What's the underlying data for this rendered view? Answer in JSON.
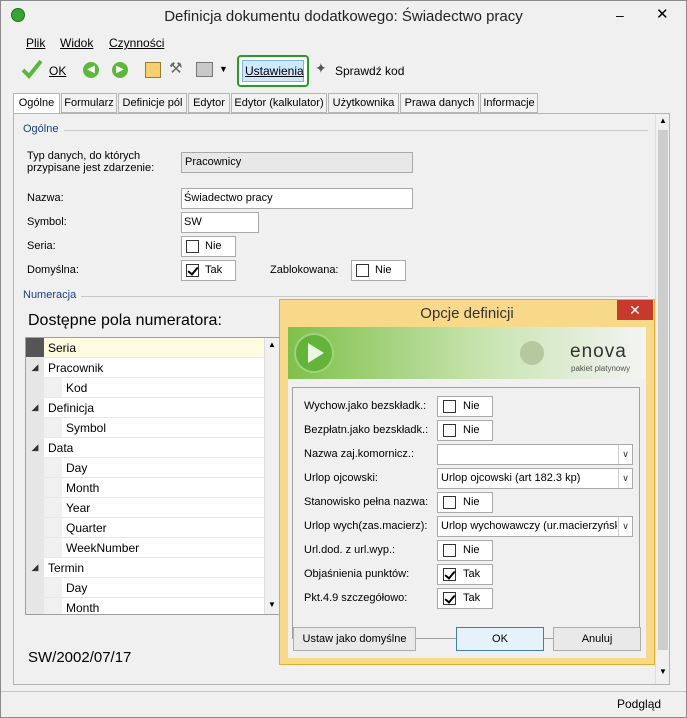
{
  "window": {
    "title": "Definicja dokumentu dodatkowego: Świadectwo pracy"
  },
  "menu": {
    "items": [
      "Plik",
      "Widok",
      "Czynności"
    ]
  },
  "toolbar": {
    "ok_label": "OK",
    "settings_label": "Ustawienia",
    "check_code_label": "Sprawdź kod"
  },
  "tabs": [
    "Ogólne",
    "Formularz",
    "Definicje pól",
    "Edytor",
    "Edytor (kalkulator)",
    "Użytkownika",
    "Prawa danych",
    "Informacje"
  ],
  "general": {
    "section_title": "Ogólne",
    "data_type_label": "Typ danych, do których przypisane jest zdarzenie:",
    "data_type_value": "Pracownicy",
    "name_label": "Nazwa:",
    "name_value": "Świadectwo pracy",
    "symbol_label": "Symbol:",
    "symbol_value": "SW",
    "series_label": "Seria:",
    "series_value": "Nie",
    "default_label": "Domyślna:",
    "default_value": "Tak",
    "blocked_label": "Zablokowana:",
    "blocked_value": "Nie"
  },
  "numbering": {
    "section_title": "Numeracja",
    "fields_title": "Dostępne pola numeratora:",
    "rows": [
      {
        "label": "Seria",
        "level": 0,
        "group": false,
        "selected": true
      },
      {
        "label": "Pracownik",
        "level": 0,
        "group": true
      },
      {
        "label": "Kod",
        "level": 1,
        "group": false
      },
      {
        "label": "Definicja",
        "level": 0,
        "group": true
      },
      {
        "label": "Symbol",
        "level": 1,
        "group": false
      },
      {
        "label": "Data",
        "level": 0,
        "group": true
      },
      {
        "label": "Day",
        "level": 1,
        "group": false
      },
      {
        "label": "Month",
        "level": 1,
        "group": false
      },
      {
        "label": "Year",
        "level": 1,
        "group": false
      },
      {
        "label": "Quarter",
        "level": 1,
        "group": false
      },
      {
        "label": "WeekNumber",
        "level": 1,
        "group": false
      },
      {
        "label": "Termin",
        "level": 0,
        "group": true
      },
      {
        "label": "Day",
        "level": 1,
        "group": false
      },
      {
        "label": "Month",
        "level": 1,
        "group": false
      }
    ],
    "preview": "SW/2002/07/17"
  },
  "statusbar": {
    "preview_label": "Podgląd"
  },
  "dialog": {
    "title": "Opcje definicji",
    "logo_text": "enova",
    "logo_sub": "pakiet platynowy",
    "fields": [
      {
        "label": "Wychow.jako bezskładk.:",
        "type": "check",
        "checked": false,
        "value": "Nie"
      },
      {
        "label": "Bezpłatn.jako bezskładk.:",
        "type": "check",
        "checked": false,
        "value": "Nie"
      },
      {
        "label": "Nazwa zaj.komornicz.:",
        "type": "combo",
        "value": ""
      },
      {
        "label": "Urlop ojcowski:",
        "type": "combo",
        "value": "Urlop ojcowski (art 182.3 kp)"
      },
      {
        "label": "Stanowisko pełna nazwa:",
        "type": "check",
        "checked": false,
        "value": "Nie"
      },
      {
        "label": "Urlop wych(zas.macierz):",
        "type": "combo",
        "value": "Urlop wychowawczy (ur.macierzyńsk"
      },
      {
        "label": "Url.dod. z url.wyp.:",
        "type": "check",
        "checked": false,
        "value": "Nie"
      },
      {
        "label": "Objaśnienia punktów:",
        "type": "check",
        "checked": true,
        "value": "Tak"
      },
      {
        "label": "Pkt.4.9 szczegółowo:",
        "type": "check",
        "checked": true,
        "value": "Tak"
      }
    ],
    "set_default_label": "Ustaw jako domyślne",
    "ok_label": "OK",
    "cancel_label": "Anuluj"
  },
  "colors": {
    "accent_green": "#3aa335",
    "selected_row": "#fffbe0",
    "dialog_border": "#e0b030"
  }
}
